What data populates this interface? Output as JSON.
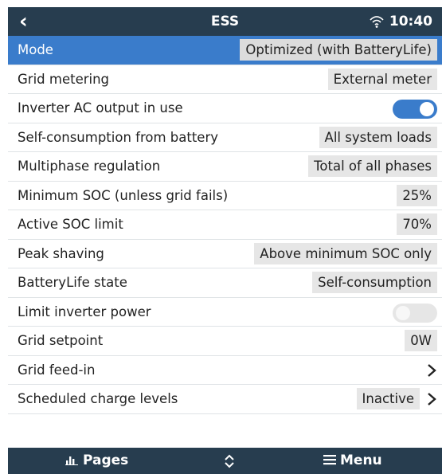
{
  "header": {
    "title": "ESS",
    "time": "10:40"
  },
  "rows": [
    {
      "label": "Mode",
      "value": "Optimized (with BatteryLife)"
    },
    {
      "label": "Grid metering",
      "value": "External meter"
    },
    {
      "label": "Inverter AC output in use",
      "toggle": true
    },
    {
      "label": "Self-consumption from battery",
      "value": "All system loads"
    },
    {
      "label": "Multiphase regulation",
      "value": "Total of all phases"
    },
    {
      "label": "Minimum SOC (unless grid fails)",
      "value": "25%"
    },
    {
      "label": "Active SOC limit",
      "value": "70%"
    },
    {
      "label": "Peak shaving",
      "value": "Above minimum SOC only"
    },
    {
      "label": "BatteryLife state",
      "value": "Self-consumption"
    },
    {
      "label": "Limit inverter power",
      "toggle": false
    },
    {
      "label": "Grid setpoint",
      "value": "0W"
    },
    {
      "label": "Grid feed-in"
    },
    {
      "label": "Scheduled charge levels",
      "value": "Inactive"
    }
  ],
  "footer": {
    "pages_label": "Pages",
    "menu_label": "Menu"
  },
  "colors": {
    "bar": "#273d4f",
    "accent": "#3a7ccb"
  }
}
